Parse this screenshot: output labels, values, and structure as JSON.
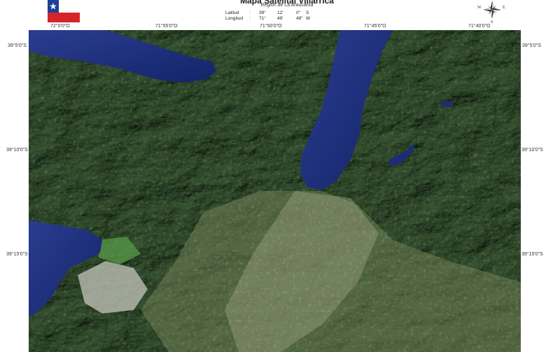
{
  "header": {
    "title": "Mapa Satelital Villarrica",
    "region": "Región de La Araucanía",
    "coordinates": {
      "lat_label": "Latitud",
      "lat_sep": ":",
      "lat_deg": "39°",
      "lat_min": "12'",
      "lat_sec": "0\"",
      "lat_hem": "S",
      "lon_label": "Longitud",
      "lon_sep": ":",
      "lon_deg": "71°",
      "lon_min": "49'",
      "lon_sec": "48\"",
      "lon_hem": "W"
    }
  },
  "compass": {
    "w": "W",
    "e": "E",
    "n": "N",
    "s": "S"
  },
  "graticule": {
    "top": [
      "72°0'0\"O",
      "71°55'0\"O",
      "71°50'0\"O",
      "71°45'0\"O",
      "71°40'0\"O"
    ],
    "left": [
      "39°5'0\"S",
      "39°10'0\"S",
      "39°15'0\"S"
    ],
    "right": [
      "39°5'0\"S",
      "39°10'0\"S",
      "39°15'0\"S"
    ]
  },
  "colors": {
    "forest": "#2c4a2c",
    "water": "#1b2e7a",
    "urban": "#b9bab0",
    "field": "#7a8a5a"
  }
}
